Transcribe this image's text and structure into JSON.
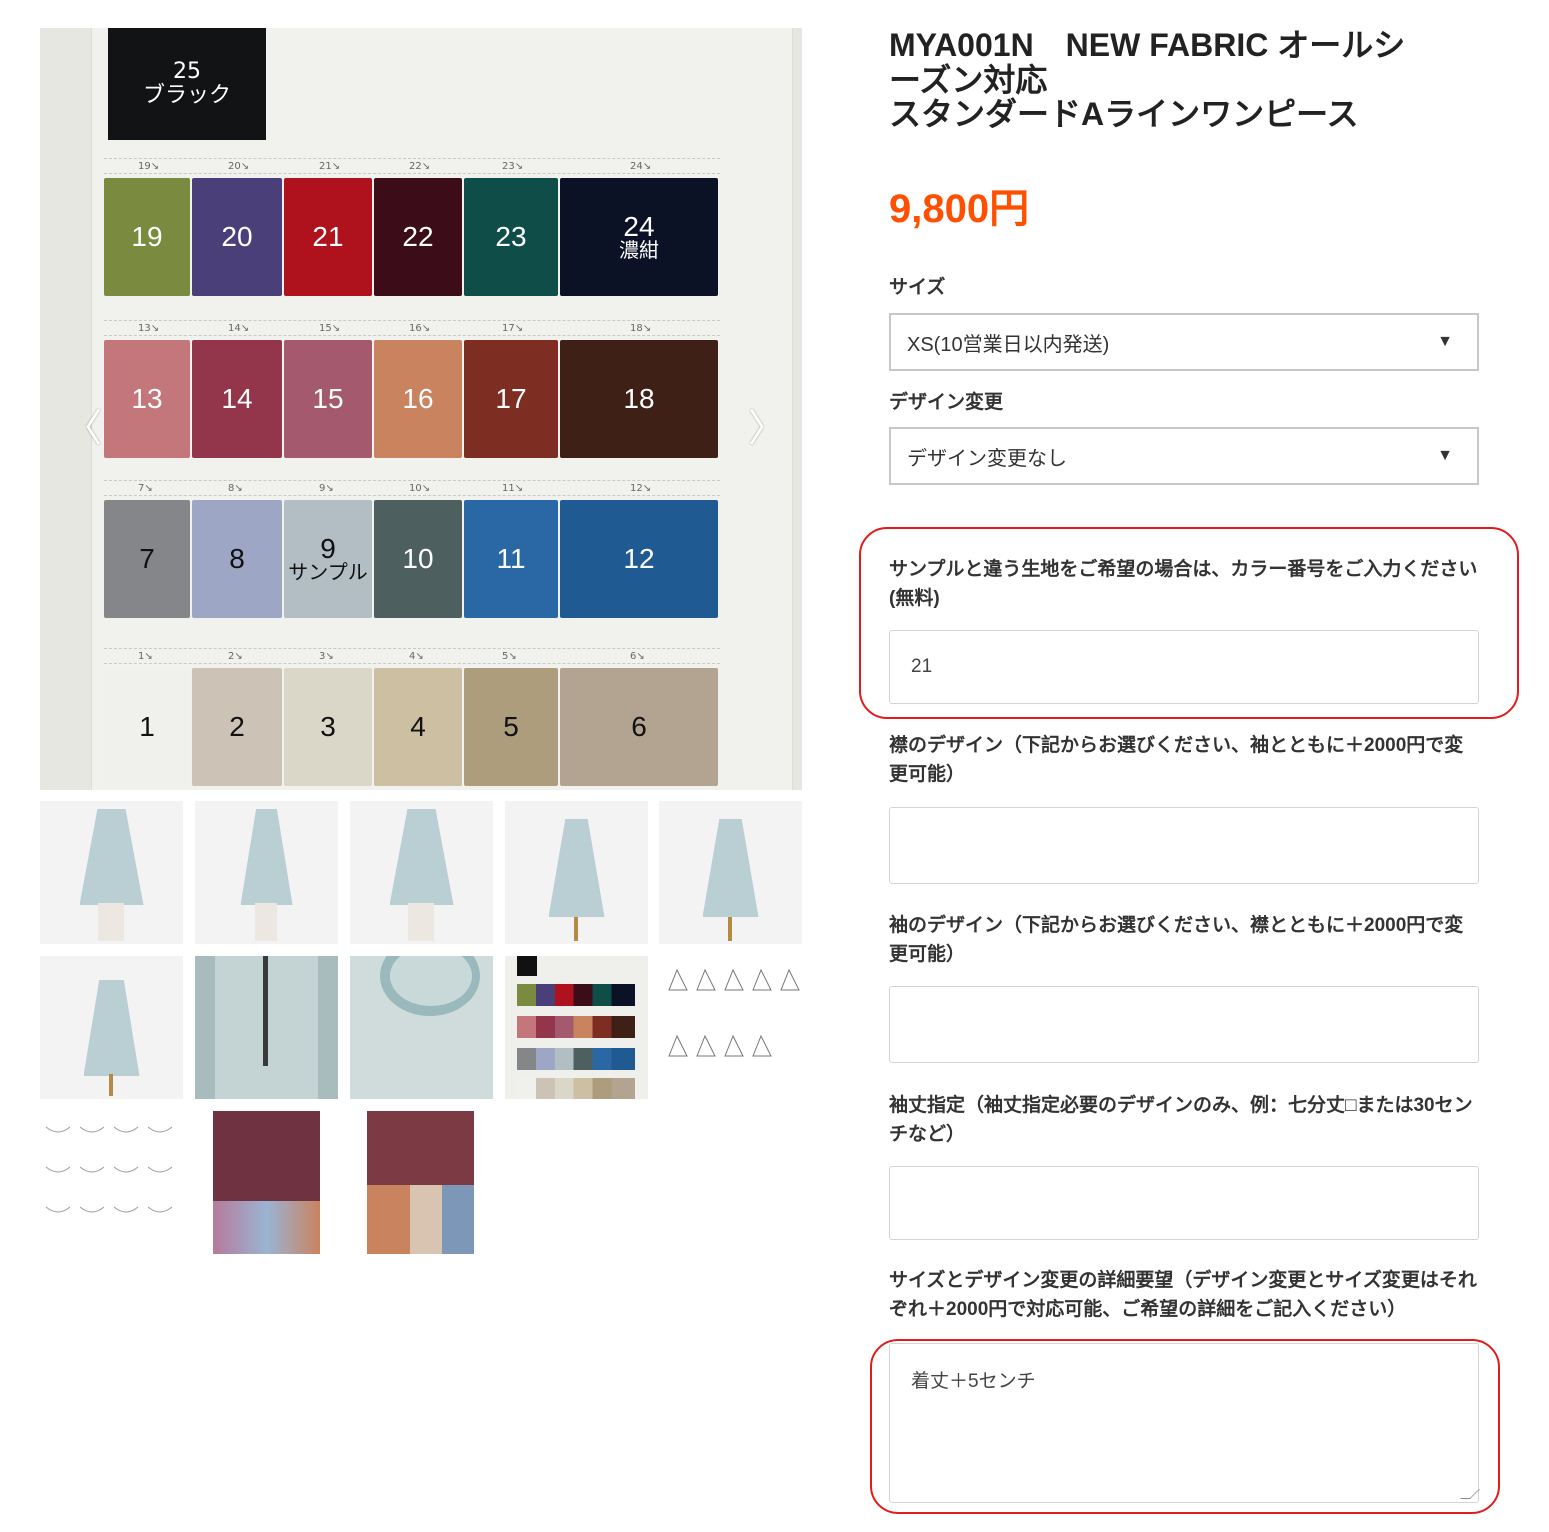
{
  "gallery": {
    "prev_arrow": "〈",
    "next_arrow": "〉",
    "top_swatch": {
      "number": "25",
      "name": "ブラック"
    },
    "rows": [
      {
        "labels": [
          "19↘",
          "20↘",
          "21↘",
          "22↘",
          "23↘",
          "24↘"
        ],
        "swatches": [
          {
            "num": "19",
            "color": "#7a8a3e"
          },
          {
            "num": "20",
            "color": "#4b3f7a"
          },
          {
            "num": "21",
            "color": "#b0121d"
          },
          {
            "num": "22",
            "color": "#3c0d18"
          },
          {
            "num": "23",
            "color": "#0e4d48"
          },
          {
            "num": "24",
            "name": "濃紺",
            "color": "#0b1226"
          }
        ]
      },
      {
        "labels": [
          "13↘",
          "14↘",
          "15↘",
          "16↘",
          "17↘",
          "18↘"
        ],
        "swatches": [
          {
            "num": "13",
            "color": "#c4777a"
          },
          {
            "num": "14",
            "color": "#93354b"
          },
          {
            "num": "15",
            "color": "#a4596f"
          },
          {
            "num": "16",
            "color": "#c9835f"
          },
          {
            "num": "17",
            "color": "#7d2d21"
          },
          {
            "num": "18",
            "color": "#3e2016"
          }
        ]
      },
      {
        "labels": [
          "7↘",
          "8↘",
          "9↘",
          "10↘",
          "11↘",
          "12↘"
        ],
        "swatches": [
          {
            "num": "7",
            "color": "#858689",
            "light": true
          },
          {
            "num": "8",
            "color": "#9da6c4",
            "light": true
          },
          {
            "num": "9",
            "name": "サンプル",
            "color": "#b2bdc4",
            "light": true
          },
          {
            "num": "10",
            "color": "#4e5f5f"
          },
          {
            "num": "11",
            "color": "#2a68a5"
          },
          {
            "num": "12",
            "color": "#1f5a93"
          }
        ]
      },
      {
        "labels": [
          "1↘",
          "2↘",
          "3↘",
          "4↘",
          "5↘",
          "6↘"
        ],
        "swatches": [
          {
            "num": "1",
            "color": "#f0f0ec",
            "light": true
          },
          {
            "num": "2",
            "color": "#cdc2b6",
            "light": true
          },
          {
            "num": "3",
            "color": "#dad6c8",
            "light": true
          },
          {
            "num": "4",
            "color": "#cdbfa2",
            "light": true
          },
          {
            "num": "5",
            "color": "#ad9d7c",
            "light": true
          },
          {
            "num": "6",
            "color": "#b2a491",
            "light": true
          }
        ]
      }
    ]
  },
  "product": {
    "title_line1": "MYA001N　NEW FABRIC オールシ",
    "title_line2": "ーズン対応",
    "title_line3": "スタンダードAラインワンピース",
    "price": "9,800円"
  },
  "options": {
    "size_label": "サイズ",
    "size_value": "XS(10営業日以内発送)",
    "design_label": "デザイン変更",
    "design_value": "デザイン変更なし",
    "color_label": "サンプルと違う生地をご希望の場合は、カラー番号をご入力ください(無料)",
    "color_value": "21",
    "collar_label": "襟のデザイン（下記からお選びください、袖とともに＋2000円で変更可能）",
    "collar_value": "",
    "sleeve_label": "袖のデザイン（下記からお選びください、襟とともに＋2000円で変更可能）",
    "sleeve_value": "",
    "sleeve_length_label": "袖丈指定（袖丈指定必要のデザインのみ、例：七分丈□または30センチなど）",
    "sleeve_length_value": "",
    "details_label": "サイズとデザイン変更の詳細要望（デザイン変更とサイズ変更はそれぞれ＋2000円で対応可能、ご希望の詳細をご記入ください）",
    "details_value": "着丈＋5センチ"
  },
  "colors": {
    "accent_price": "#ff4f00",
    "highlight": "#e21b1b"
  }
}
